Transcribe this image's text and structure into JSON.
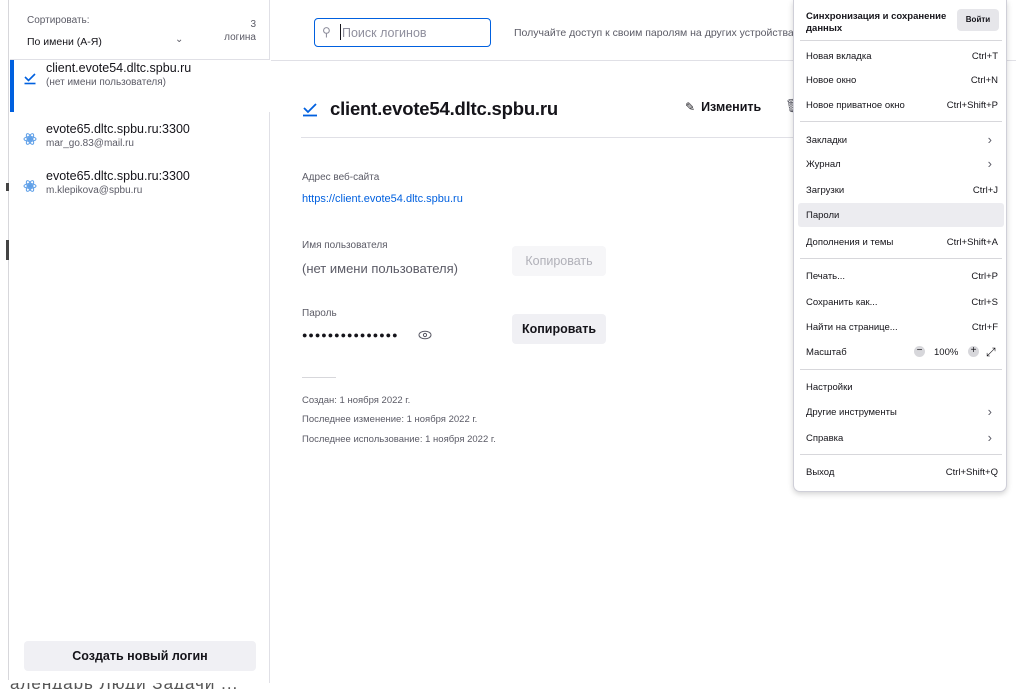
{
  "sidebar": {
    "sort_label": "Сортировать:",
    "sort_value": "По имени (А-Я)",
    "count_number": "3",
    "count_word": "логина",
    "items": [
      {
        "title": "client.evote54.dltc.spbu.ru",
        "subtitle": "(нет имени пользователя)",
        "icon": "key-check-icon"
      },
      {
        "title": "evote65.dltc.spbu.ru:3300",
        "subtitle": "mar_go.83@mail.ru",
        "icon": "globe-icon"
      },
      {
        "title": "evote65.dltc.spbu.ru:3300",
        "subtitle": "m.klepikova@spbu.ru",
        "icon": "globe-icon"
      }
    ],
    "create_label": "Создать новый логин"
  },
  "header": {
    "search_placeholder": "Поиск логинов",
    "sync_message": "Получайте доступ к своим паролям на других устройствах"
  },
  "entry": {
    "title": "client.evote54.dltc.spbu.ru",
    "edit_label": "Изменить",
    "website_label": "Адрес веб-сайта",
    "website_value": "https://client.evote54.dltc.spbu.ru",
    "username_label": "Имя пользователя",
    "username_value": "(нет имени пользователя)",
    "copy_label": "Копировать",
    "password_label": "Пароль",
    "password_value": "●●●●●●●●●●●●●●●",
    "created": "Создан: 1 ноября 2022 г.",
    "modified": "Последнее изменение: 1 ноября 2022 г.",
    "used": "Последнее использование: 1 ноября 2022 г."
  },
  "menu": {
    "sync_title_1": "Синхронизация и сохранение",
    "sync_title_2": "данных",
    "signin": "Войти",
    "items": [
      {
        "label": "Новая вкладка",
        "shortcut": "Ctrl+T"
      },
      {
        "label": "Новое окно",
        "shortcut": "Ctrl+N"
      },
      {
        "label": "Новое приватное окно",
        "shortcut": "Ctrl+Shift+P"
      },
      {
        "label": "Закладки",
        "shortcut": ""
      },
      {
        "label": "Журнал",
        "shortcut": ""
      },
      {
        "label": "Загрузки",
        "shortcut": "Ctrl+J"
      },
      {
        "label": "Пароли",
        "shortcut": ""
      },
      {
        "label": "Дополнения и темы",
        "shortcut": "Ctrl+Shift+A"
      },
      {
        "label": "Печать...",
        "shortcut": "Ctrl+P"
      },
      {
        "label": "Сохранить как...",
        "shortcut": "Ctrl+S"
      },
      {
        "label": "Найти на странице...",
        "shortcut": "Ctrl+F"
      },
      {
        "label": "Масштаб",
        "shortcut": ""
      },
      {
        "label": "Настройки",
        "shortcut": ""
      },
      {
        "label": "Другие инструменты",
        "shortcut": ""
      },
      {
        "label": "Справка",
        "shortcut": ""
      },
      {
        "label": "Выход",
        "shortcut": "Ctrl+Shift+Q"
      }
    ],
    "zoom_value": "100%"
  },
  "background_text": "алендарь  Люди  Задачи  ...",
  "colors": {
    "accent": "#0060df",
    "login_icon": "#0060df",
    "globe_icon": "#5e9fe8"
  }
}
